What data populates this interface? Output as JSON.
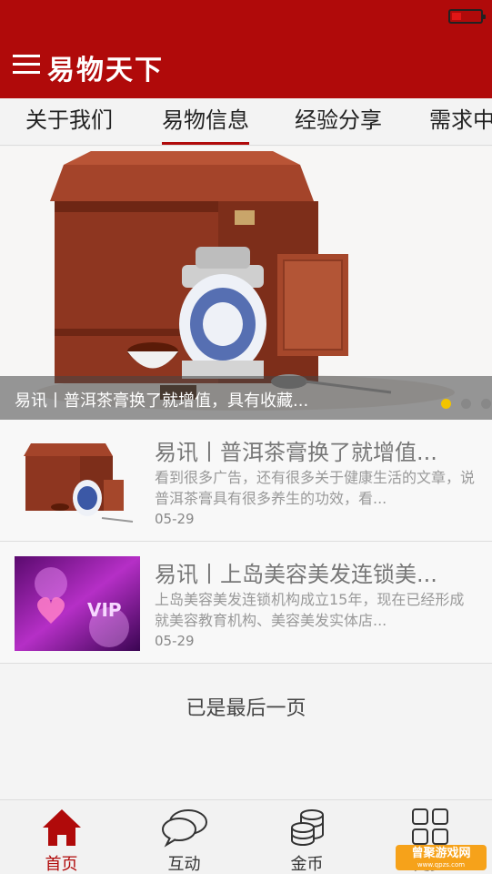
{
  "header": {
    "app_title": "易物天下"
  },
  "tabs": [
    {
      "label": "关于我们",
      "active": false
    },
    {
      "label": "易物信息",
      "active": true
    },
    {
      "label": "经验分享",
      "active": false
    },
    {
      "label": "需求中",
      "active": false
    }
  ],
  "banner": {
    "caption": "易讯丨普洱茶膏换了就增值，具有收藏...",
    "slide_count": 3,
    "active_slide": 1
  },
  "news": [
    {
      "title": "易讯丨普洱茶膏换了就增值...",
      "summary": "看到很多广告，还有很多关于健康生活的文章，说普洱茶膏具有很多养生的功效，看...",
      "date": "05-29",
      "thumb_icon": "tea-box-thumbnail"
    },
    {
      "title": "易讯丨上岛美容美发连锁美...",
      "summary": "上岛美容美发连锁机构成立15年，现在已经形成就美容教育机构、美容美发实体店...",
      "date": "05-29",
      "thumb_icon": "vip-beauty-thumbnail",
      "thumb_text": "VIP"
    }
  ],
  "end_note": "已是最后一页",
  "bottom_nav": [
    {
      "label": "首页",
      "icon": "home-icon",
      "active": true
    },
    {
      "label": "互动",
      "icon": "chat-bubbles-icon",
      "active": false
    },
    {
      "label": "金币",
      "icon": "coins-icon",
      "active": false
    },
    {
      "label": "更多",
      "icon": "grid-icon",
      "active": false
    }
  ],
  "watermark": {
    "text": "曾聚游戏网",
    "sub": "www.qpzs.com"
  },
  "colors": {
    "brand_red": "#b00a0a",
    "dot_active": "#f2c400"
  }
}
